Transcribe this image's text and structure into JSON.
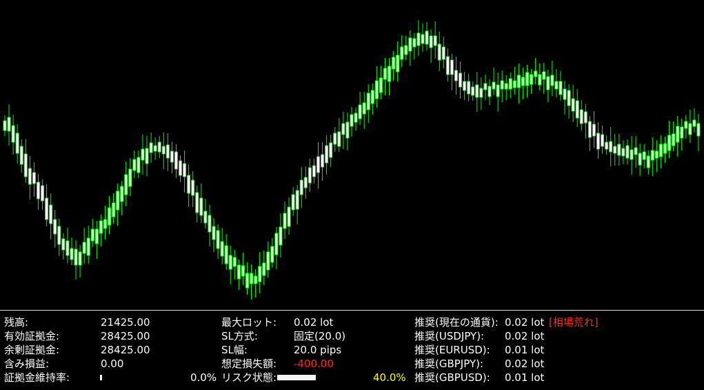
{
  "top_hud": "",
  "colors": {
    "background": "#000000",
    "candle_fill": "#ffffff",
    "candle_wick": "#00ff00",
    "text": "#ffffff",
    "loss": "#ff2a2a",
    "risk": "#ffff00",
    "divider": "#d7d7d7"
  },
  "chart_data": {
    "type": "line",
    "candles": []
  },
  "panel": {
    "balance_label": "残高:",
    "balance_value": "21425.00",
    "effective_margin_label": "有効証拠金:",
    "effective_margin_value": "28425.00",
    "free_margin_label": "余剰証拠金:",
    "free_margin_value": "28425.00",
    "floating_pl_label": "含み損益:",
    "floating_pl_value": "0.00",
    "margin_level_label": "証拠金維持率:",
    "margin_level_value": "0.0%",
    "max_lot_label": "最大ロット:",
    "max_lot_value": "0.02 lot",
    "sl_method_label": "SL方式:",
    "sl_method_value": "固定(20.0)",
    "sl_width_label": "SL幅:",
    "sl_width_value": "20.0 pips",
    "expected_loss_label": "想定損失額:",
    "expected_loss_value": "-400.00",
    "risk_state_label": "リスク状態:",
    "risk_state_value": "40.0%",
    "risk_fill_percent": 40.0,
    "rec_current_label": "推奨(現在の通貨):",
    "rec_current_value": "0.02 lot",
    "rec_current_badge": "[相場荒れ]",
    "rec_usdjpy_label": "推奨(USDJPY):",
    "rec_usdjpy_value": "0.02 lot",
    "rec_eurusd_label": "推奨(EURUSD):",
    "rec_eurusd_value": "0.01 lot",
    "rec_gbpjpy_label": "推奨(GBPJPY):",
    "rec_gbpjpy_value": "0.02 lot",
    "rec_gbpusd_label": "推奨(GBPUSD):",
    "rec_gbpusd_value": "0.01 lot"
  }
}
